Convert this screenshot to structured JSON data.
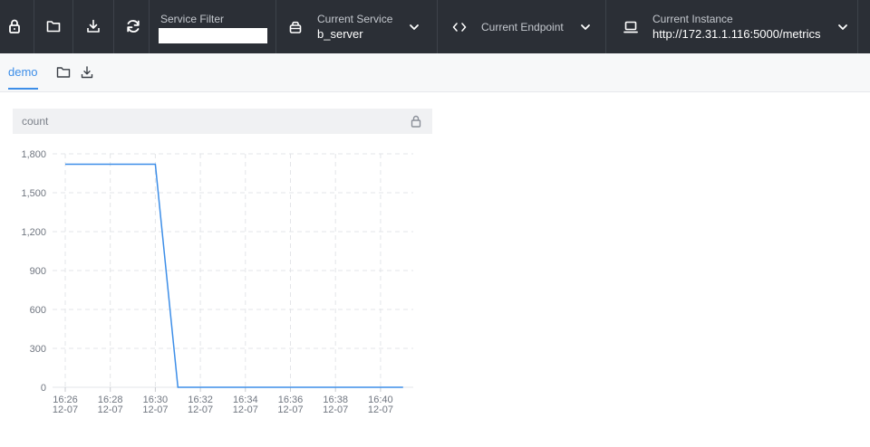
{
  "toolbar": {
    "service_filter_label": "Service Filter",
    "service_filter_value": "",
    "current_service_label": "Current Service",
    "current_service_value": "b_server",
    "current_endpoint_label": "Current Endpoint",
    "current_instance_label": "Current Instance",
    "current_instance_value": "http://172.31.1.116:5000/metrics"
  },
  "tabs": [
    {
      "label": "demo",
      "active": true
    }
  ],
  "panel": {
    "title": "count"
  },
  "icons": [
    "lock-icon",
    "folder-icon",
    "download-icon",
    "refresh-icon",
    "service-icon",
    "code-icon",
    "monitor-icon",
    "chevron-down-icon"
  ],
  "colors": {
    "topbar": "#2b2f36",
    "accent": "#3d8ee8",
    "series": "#3d8ee8"
  },
  "chart_data": {
    "type": "line",
    "title": "count",
    "y_ticks": [
      "0",
      "300",
      "600",
      "900",
      "1,200",
      "1,500",
      "1,800"
    ],
    "x_ticks": [
      {
        "time": "16:26",
        "date": "12-07"
      },
      {
        "time": "16:28",
        "date": "12-07"
      },
      {
        "time": "16:30",
        "date": "12-07"
      },
      {
        "time": "16:32",
        "date": "12-07"
      },
      {
        "time": "16:34",
        "date": "12-07"
      },
      {
        "time": "16:36",
        "date": "12-07"
      },
      {
        "time": "16:38",
        "date": "12-07"
      },
      {
        "time": "16:40",
        "date": "12-07"
      }
    ],
    "ylim": [
      0,
      1800
    ],
    "xlim": [
      "12-07 16:26",
      "12-07 16:41"
    ],
    "grid": true,
    "series": [
      {
        "points": [
          [
            "12-07 16:26",
            1720
          ],
          [
            "12-07 16:30",
            1720
          ],
          [
            "12-07 16:31",
            0
          ],
          [
            "12-07 16:41",
            0
          ]
        ]
      }
    ]
  }
}
